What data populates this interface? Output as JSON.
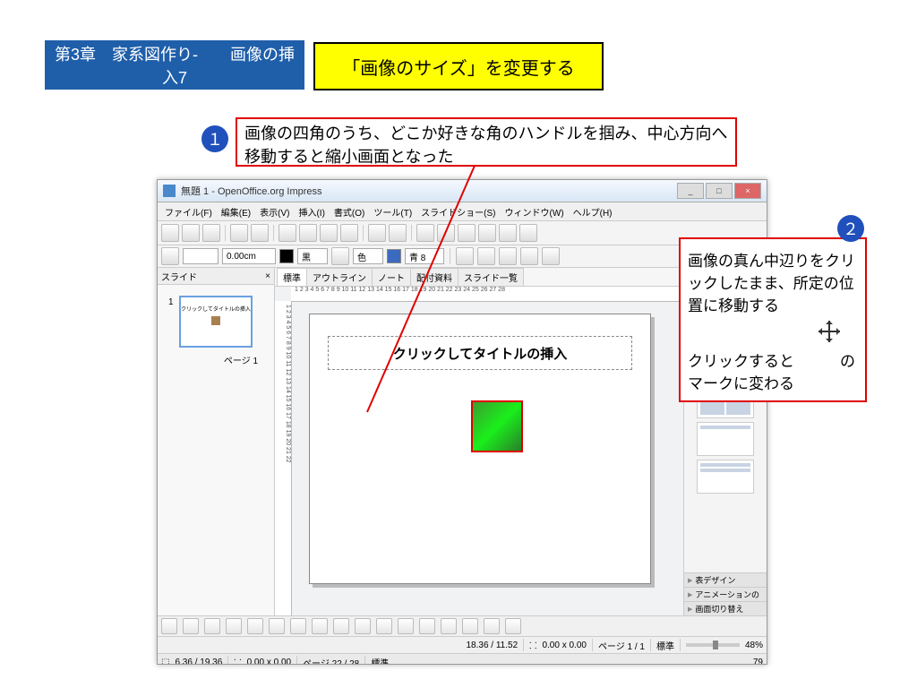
{
  "chapter": "第3章　家系図作り-　　画像の挿入7",
  "title": "「画像のサイズ」を変更する",
  "step1": {
    "num": "１",
    "text": "画像の四角のうち、どこか好きな角のハンドルを掴み、中心方向へ移動すると縮小画面となった"
  },
  "step2": {
    "num": "２",
    "line1": "画像の真ん中辺りをクリックしたまま、所定の位置に移動する",
    "line2": "クリックすると　　　のマークに変わる"
  },
  "app": {
    "window_title": "無題 1 - OpenOffice.org Impress",
    "menus": [
      "ファイル(F)",
      "編集(E)",
      "表示(V)",
      "挿入(I)",
      "書式(O)",
      "ツール(T)",
      "スライドショー(S)",
      "ウィンドウ(W)",
      "ヘルプ(H)"
    ],
    "formatbar": {
      "size": "0.00cm",
      "color1_label": "黒",
      "fill_label": "色",
      "color2_label": "青 8"
    },
    "slides_panel_label": "スライド",
    "slide_number": "1",
    "page_label": "ページ 1",
    "thumb_text": "クリックしてタイトルの挿入",
    "view_tabs": [
      "標準",
      "アウトライン",
      "ノート",
      "配付資料",
      "スライド一覧"
    ],
    "title_placeholder": "クリックしてタイトルの挿入",
    "ruler_h": "1 2 3 4 5 6 7 8 9 10 11 12 13 14 15 16 17 18 19 20 21 22 23 24 25 26 27 28",
    "ruler_v": "1 2 3 4 5 6 7 8 9 10 11 12 13 14 15 16 17 18 19 20 21 22",
    "accordion": [
      "表デザイン",
      "アニメーションの",
      "画面切り替え"
    ],
    "status1": {
      "pos": "18.36 / 11.52",
      "sel": "0.00 x 0.00",
      "page": "ページ 1 / 1",
      "mode": "標準",
      "zoom": "48%"
    },
    "status2": {
      "pos": "6.36 / 19.36",
      "sel": "0.00 x 0.00",
      "page": "ページ 22 / 28",
      "mode": "標準",
      "zoom": "79"
    }
  }
}
